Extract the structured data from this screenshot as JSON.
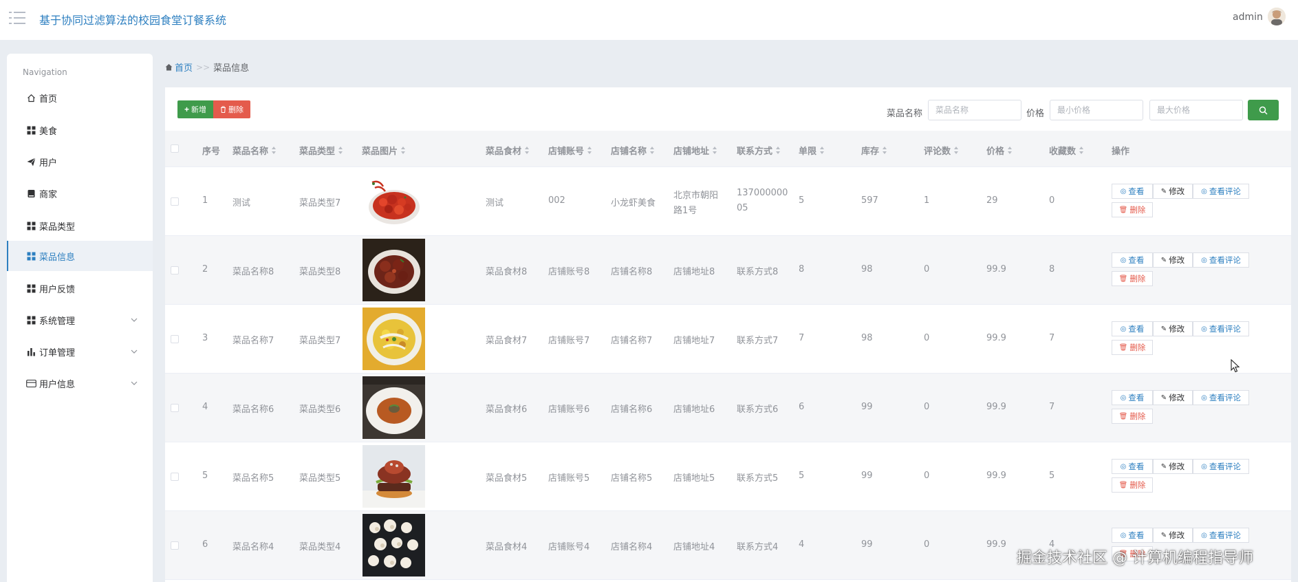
{
  "header": {
    "app_title": "基于协同过滤算法的校园食堂订餐系统",
    "user": "admin",
    "menu_icon": "list-icon",
    "avatar_icon": "user-avatar-icon"
  },
  "sidebar": {
    "caption": "Navigation",
    "items": [
      {
        "label": "首页",
        "icon": "home-icon",
        "active": false,
        "expandable": false
      },
      {
        "label": "美食",
        "icon": "grid-icon",
        "active": false,
        "expandable": false
      },
      {
        "label": "用户",
        "icon": "send-icon",
        "active": false,
        "expandable": false
      },
      {
        "label": "商家",
        "icon": "shop-icon",
        "active": false,
        "expandable": false
      },
      {
        "label": "菜品类型",
        "icon": "grid-icon",
        "active": false,
        "expandable": false
      },
      {
        "label": "菜品信息",
        "icon": "grid-icon",
        "active": true,
        "expandable": false
      },
      {
        "label": "用户反馈",
        "icon": "grid-icon",
        "active": false,
        "expandable": false
      },
      {
        "label": "系统管理",
        "icon": "grid-icon",
        "active": false,
        "expandable": true
      },
      {
        "label": "订单管理",
        "icon": "bar-chart-icon",
        "active": false,
        "expandable": true
      },
      {
        "label": "用户信息",
        "icon": "card-icon",
        "active": false,
        "expandable": true
      }
    ]
  },
  "breadcrumb": {
    "home": "首页",
    "separator": ">>",
    "current": "菜品信息"
  },
  "toolbar": {
    "add_label": "新增",
    "delete_label": "删除",
    "search_label": "菜品名称",
    "search_placeholder": "菜品名称",
    "price_label": "价格",
    "min_price_placeholder": "最小价格",
    "max_price_placeholder": "最大价格",
    "search_icon": "search-icon"
  },
  "table": {
    "columns": [
      "序号",
      "菜品名称",
      "菜品类型",
      "菜品图片",
      "菜品食材",
      "店铺账号",
      "店铺名称",
      "店铺地址",
      "联系方式",
      "单限",
      "库存",
      "评论数",
      "价格",
      "收藏数",
      "操作"
    ],
    "actions": {
      "view": "查看",
      "edit": "修改",
      "comments": "查看评论",
      "delete": "删除"
    },
    "rows": [
      {
        "index": "1",
        "name": "测试",
        "type": "菜品类型7",
        "image": "crayfish",
        "ingredients": "测试",
        "shop_account": "002",
        "shop_name": "小龙虾美食",
        "shop_address_line1": "北京市朝阳",
        "shop_address_line2": "路1号",
        "contact_line1": "137000000",
        "contact_line2": "05",
        "limit": "5",
        "stock": "597",
        "comments": "1",
        "price": "29",
        "favorites": "0"
      },
      {
        "index": "2",
        "name": "菜品名称8",
        "type": "菜品类型8",
        "image": "braised-pork",
        "ingredients": "菜品食材8",
        "shop_account": "店铺账号8",
        "shop_name": "店铺名称8",
        "shop_address_line1": "店铺地址8",
        "shop_address_line2": "",
        "contact_line1": "联系方式8",
        "contact_line2": "",
        "limit": "8",
        "stock": "98",
        "comments": "0",
        "price": "99.9",
        "favorites": "8"
      },
      {
        "index": "3",
        "name": "菜品名称7",
        "type": "菜品类型7",
        "image": "stir-fry",
        "ingredients": "菜品食材7",
        "shop_account": "店铺账号7",
        "shop_name": "店铺名称7",
        "shop_address_line1": "店铺地址7",
        "shop_address_line2": "",
        "contact_line1": "联系方式7",
        "contact_line2": "",
        "limit": "7",
        "stock": "98",
        "comments": "0",
        "price": "99.9",
        "favorites": "7"
      },
      {
        "index": "4",
        "name": "菜品名称6",
        "type": "菜品类型6",
        "image": "soup",
        "ingredients": "菜品食材6",
        "shop_account": "店铺账号6",
        "shop_name": "店铺名称6",
        "shop_address_line1": "店铺地址6",
        "shop_address_line2": "",
        "contact_line1": "联系方式6",
        "contact_line2": "",
        "limit": "6",
        "stock": "99",
        "comments": "0",
        "price": "99.9",
        "favorites": "7"
      },
      {
        "index": "5",
        "name": "菜品名称5",
        "type": "菜品类型5",
        "image": "burger",
        "ingredients": "菜品食材5",
        "shop_account": "店铺账号5",
        "shop_name": "店铺名称5",
        "shop_address_line1": "店铺地址5",
        "shop_address_line2": "",
        "contact_line1": "联系方式5",
        "contact_line2": "",
        "limit": "5",
        "stock": "99",
        "comments": "0",
        "price": "99.9",
        "favorites": "5"
      },
      {
        "index": "6",
        "name": "菜品名称4",
        "type": "菜品类型4",
        "image": "cauliflower",
        "ingredients": "菜品食材4",
        "shop_account": "店铺账号4",
        "shop_name": "店铺名称4",
        "shop_address_line1": "店铺地址4",
        "shop_address_line2": "",
        "contact_line1": "联系方式4",
        "contact_line2": "",
        "limit": "4",
        "stock": "99",
        "comments": "0",
        "price": "99.9",
        "favorites": "4"
      }
    ]
  },
  "watermark": "掘金技术社区 @ 计算机编程指导师",
  "colors": {
    "accent": "#2d7fc0",
    "success": "#3f9b4b",
    "danger": "#e45b4c",
    "background": "#e9edf2"
  }
}
